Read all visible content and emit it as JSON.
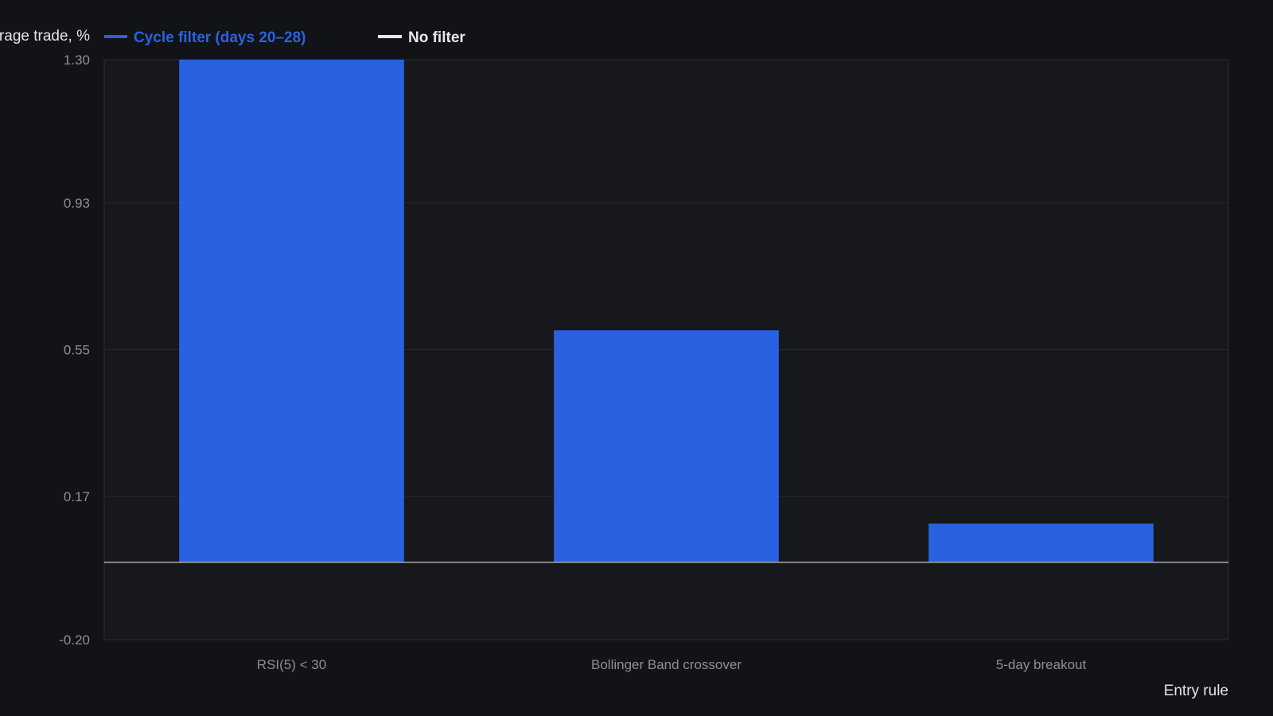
{
  "chart_data": {
    "type": "bar",
    "ylabel": "Average trade, %",
    "xlabel": "Entry rule",
    "categories": [
      "RSI(5) < 30",
      "Bollinger Band crossover",
      "5-day breakout"
    ],
    "series": [
      {
        "name": "Cycle filter (days 20–28)",
        "color": "#2962e0",
        "values": [
          1.3,
          0.6,
          0.1
        ]
      },
      {
        "name": "No filter",
        "color": "#e8e8e8",
        "values": [
          null,
          null,
          null
        ]
      }
    ],
    "yticks": [
      "1.30",
      "0.93",
      "0.55",
      "0.17",
      "-0.20"
    ],
    "ytick_values": [
      1.3,
      0.93,
      0.55,
      0.17,
      -0.2
    ],
    "ylim": [
      -0.2,
      1.3
    ],
    "grid": true,
    "legend_position": "top-left"
  },
  "colors": {
    "background": "#121317",
    "plot_background": "#17181c",
    "grid": "#26282d",
    "frame": "#2c2e34",
    "zero_line": "#a9abb0"
  }
}
